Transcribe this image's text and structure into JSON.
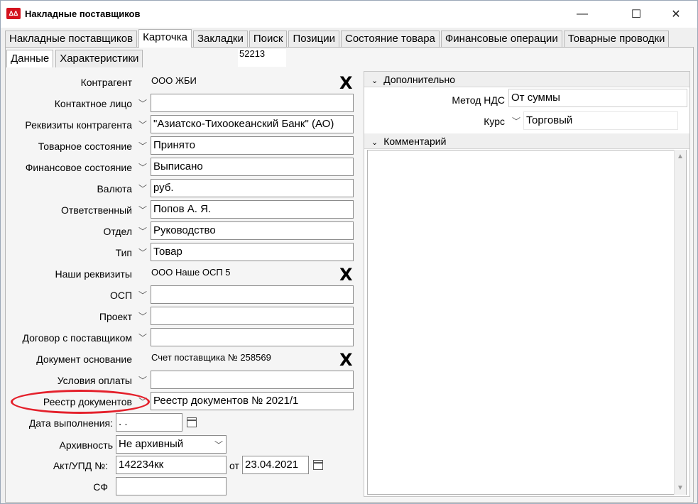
{
  "window": {
    "title": "Накладные поставщиков",
    "app_icon": "app-logo-icon",
    "controls": {
      "minimize": "—",
      "maximize": "☐",
      "close": "✕"
    }
  },
  "tabs": [
    {
      "label": "Накладные поставщиков",
      "active": false
    },
    {
      "label": "Карточка",
      "active": true
    },
    {
      "label": "Закладки",
      "active": false
    },
    {
      "label": "Поиск",
      "active": false
    },
    {
      "label": "Позиции",
      "active": false
    },
    {
      "label": "Состояние товара",
      "active": false
    },
    {
      "label": "Финансовые операции",
      "active": false
    },
    {
      "label": "Товарные проводки",
      "active": false
    }
  ],
  "subtabs": [
    {
      "label": "Данные",
      "active": true
    },
    {
      "label": "Характеристики",
      "active": false
    }
  ],
  "doc_number": "52213",
  "form": {
    "kontragent": {
      "label": "Контрагент",
      "value": "ООО ЖБИ"
    },
    "kontakt": {
      "label": "Контактное лицо",
      "value": ""
    },
    "rekvizity_kontragenta": {
      "label": "Реквизиты контрагента",
      "value": "\"Азиатско-Тихоокеанский Банк\" (АО)"
    },
    "tovar_sost": {
      "label": "Товарное состояние",
      "value": "Принято"
    },
    "fin_sost": {
      "label": "Финансовое состояние",
      "value": "Выписано"
    },
    "valuta": {
      "label": "Валюта",
      "value": "руб."
    },
    "otvetstvenny": {
      "label": "Ответственный",
      "value": "Попов А. Я."
    },
    "otdel": {
      "label": "Отдел",
      "value": "Руководство"
    },
    "tip": {
      "label": "Тип",
      "value": "Товар"
    },
    "nashi_rekvizity": {
      "label": "Наши реквизиты",
      "value": "ООО Наше ОСП 5"
    },
    "osp": {
      "label": "ОСП",
      "value": ""
    },
    "proekt": {
      "label": "Проект",
      "value": ""
    },
    "dogovor": {
      "label": "Договор с поставщиком",
      "value": ""
    },
    "doc_osnovanie": {
      "label": "Документ основание",
      "value": "Счет поставщика № 258569"
    },
    "usloviya": {
      "label": "Условия оплаты",
      "value": ""
    },
    "reestr": {
      "label": "Реестр документов",
      "value": "Реестр документов № 2021/1"
    },
    "data_vypolneniya": {
      "label": "Дата выполнения:",
      "value": " .  ."
    },
    "arkhivnost": {
      "label": "Архивность",
      "value": "Не архивный"
    },
    "akt": {
      "label": "Акт/УПД №:",
      "value": "142234кк",
      "ot_label": "от",
      "date": "23.04.2021"
    },
    "sf": {
      "label": "СФ",
      "value": ""
    },
    "clear_symbol": "X"
  },
  "right": {
    "dopolnitelno": {
      "header": "Дополнительно",
      "nds_label": "Метод НДС",
      "nds_value": "От суммы",
      "kurs_label": "Курс",
      "kurs_value": "Торговый"
    },
    "kommentariy": {
      "header": "Комментарий",
      "value": ""
    }
  }
}
